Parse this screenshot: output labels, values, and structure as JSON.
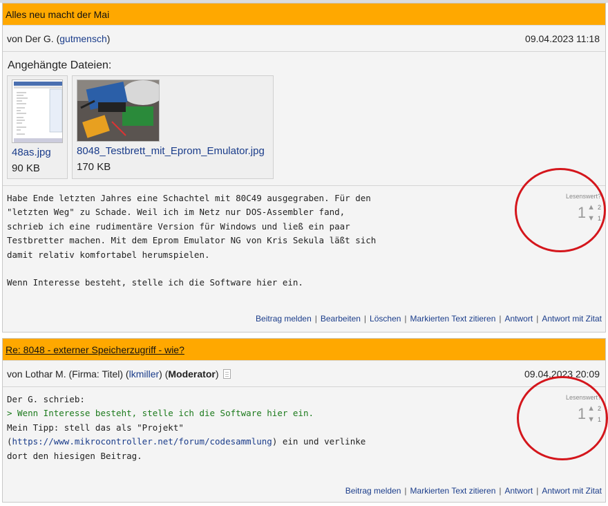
{
  "post1": {
    "title": "Alles neu macht der Mai",
    "author_prefix": "von Der G. (",
    "username": "gutmensch",
    "author_suffix": ")",
    "date": "09.04.2023 11:18",
    "attachments_title": "Angehängte Dateien:",
    "attachments": [
      {
        "name": "48as.jpg",
        "size": "90 KB"
      },
      {
        "name": "8048_Testbrett_mit_Eprom_Emulator.jpg",
        "size": "170 KB"
      }
    ],
    "body": "Habe Ende letzten Jahres eine Schachtel mit 80C49 ausgegraben. Für den\n\"letzten Weg\" zu Schade. Weil ich im Netz nur DOS-Assembler fand,\nschrieb ich eine rudimentäre Version für Windows und ließ ein paar\nTestbretter machen. Mit dem Eprom Emulator NG von Kris Sekula läßt sich\ndamit relativ komfortabel herumspielen.\n\nWenn Interesse besteht, stelle ich die Software hier ein.",
    "rating": {
      "label": "Lesenswert?",
      "score": "1",
      "up": "2",
      "down": "1"
    },
    "actions": [
      "Beitrag melden",
      "Bearbeiten",
      "Löschen",
      "Markierten Text zitieren",
      "Antwort",
      "Antwort mit Zitat"
    ]
  },
  "post2": {
    "title": "Re: 8048 - externer Speicherzugriff - wie?",
    "author_prefix": "von Lothar M. (Firma: Titel) (",
    "username": "lkmiller",
    "author_mid": ") (",
    "role": "Moderator",
    "author_suffix": ")",
    "date": "09.04.2023 20:09",
    "body_line1": "Der G. schrieb:",
    "quote": "> Wenn Interesse besteht, stelle ich die Software hier ein.",
    "body_line3": "Mein Tipp: stell das als \"Projekt\"",
    "body_line4_pre": "(",
    "link": "https://www.mikrocontroller.net/forum/codesammlung",
    "body_line4_post": ") ein und verlinke",
    "body_line5": "dort den hiesigen Beitrag.",
    "rating": {
      "label": "Lesenswert?",
      "score": "1",
      "up": "2",
      "down": "1"
    },
    "actions": [
      "Beitrag melden",
      "Markierten Text zitieren",
      "Antwort",
      "Antwort mit Zitat"
    ]
  },
  "colors": {
    "header_bg": "#ffa800",
    "link": "#1a3c8a",
    "quote": "#1c7a1c",
    "annotation_circle": "#d4161c"
  },
  "icons": [
    "arrow-up-icon",
    "arrow-down-icon",
    "document-icon"
  ]
}
